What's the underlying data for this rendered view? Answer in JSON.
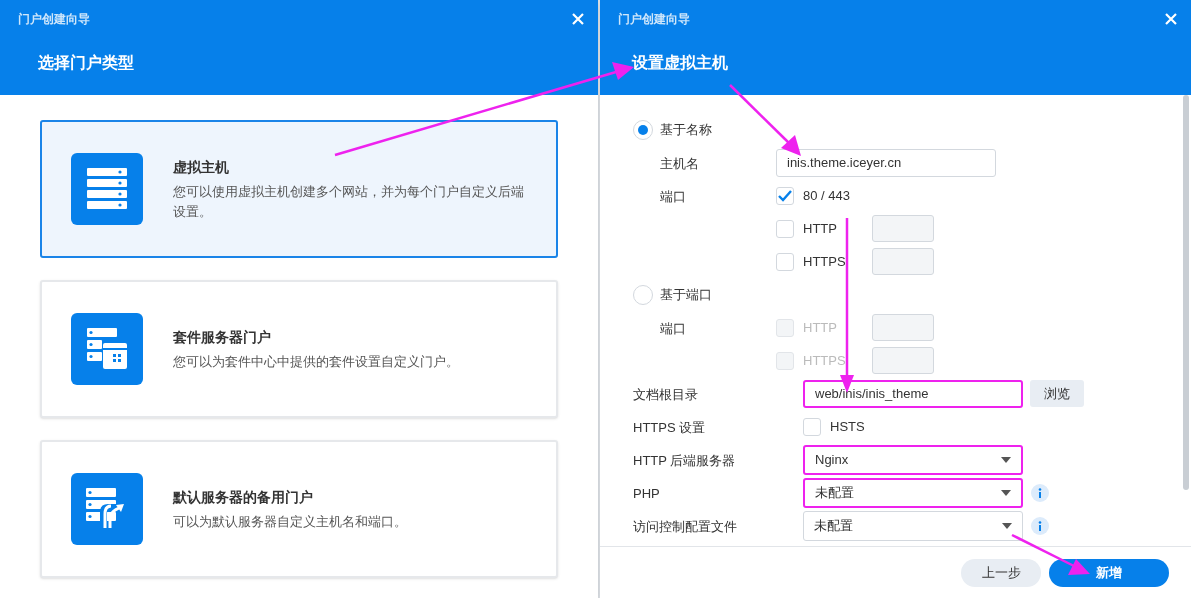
{
  "left_dialog": {
    "title": "门户创建向导",
    "heading": "选择门户类型",
    "cards": [
      {
        "kind": "virtual_host",
        "title": "虚拟主机",
        "description": "您可以使用虚拟主机创建多个网站，并为每个门户自定义后端设置。",
        "selected": true
      },
      {
        "kind": "package_server",
        "title": "套件服务器门户",
        "description": "您可以为套件中心中提供的套件设置自定义门户。",
        "selected": false
      },
      {
        "kind": "default_server",
        "title": "默认服务器的备用门户",
        "description": "可以为默认服务器自定义主机名和端口。",
        "selected": false
      }
    ]
  },
  "right_dialog": {
    "title": "门户创建向导",
    "heading": "设置虚拟主机",
    "rows": [
      {
        "kind": "radio",
        "label": "基于名称",
        "selected": true,
        "children": [
          {
            "kind": "text",
            "label": "主机名",
            "value": "inis.theme.iceyer.cn",
            "highlighted": false
          },
          {
            "kind": "checkbox",
            "label": "端口",
            "option": "80 / 443",
            "checked": true,
            "disabled": false
          },
          {
            "kind": "port",
            "option": "HTTP",
            "checked": false,
            "disabled": false
          },
          {
            "kind": "port",
            "option": "HTTPS",
            "checked": false,
            "disabled": false
          }
        ]
      },
      {
        "kind": "radio",
        "label": "基于端口",
        "selected": false,
        "children": [
          {
            "kind": "port",
            "label": "端口",
            "option": "HTTP",
            "checked": false,
            "disabled": true
          },
          {
            "kind": "port",
            "option": "HTTPS",
            "checked": false,
            "disabled": true
          }
        ]
      },
      {
        "kind": "text",
        "label": "文档根目录",
        "value": "web/inis/inis_theme",
        "highlighted": true,
        "button": "浏览"
      },
      {
        "kind": "checkbox",
        "label": "HTTPS 设置",
        "option": "HSTS",
        "checked": false,
        "disabled": false
      },
      {
        "kind": "select",
        "label": "HTTP 后端服务器",
        "value": "Nginx",
        "highlighted": true,
        "info": false
      },
      {
        "kind": "select",
        "label": "PHP",
        "value": "未配置",
        "highlighted": true,
        "info": true
      },
      {
        "kind": "select",
        "label": "访问控制配置文件",
        "value": "未配置",
        "highlighted": false,
        "info": true
      }
    ],
    "buttons": [
      {
        "label": "上一步",
        "primary": false
      },
      {
        "label": "新增",
        "primary": true
      }
    ]
  }
}
